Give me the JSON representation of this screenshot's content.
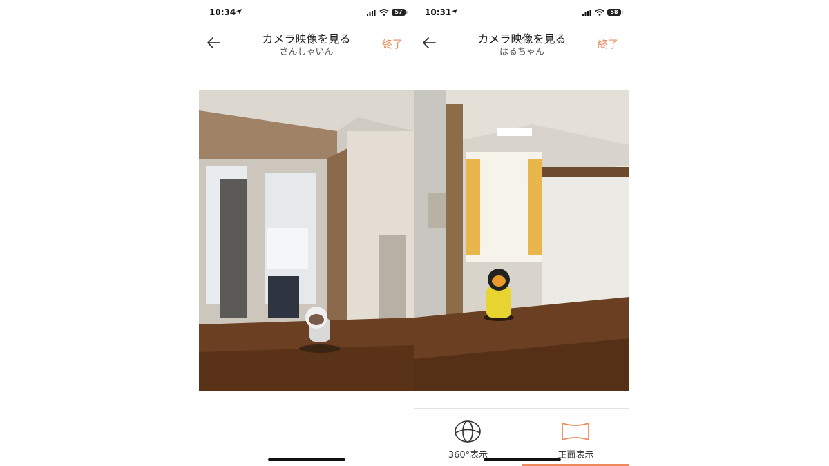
{
  "left_screen": {
    "status": {
      "time": "10:34",
      "battery": "57"
    },
    "nav": {
      "title": "カメラ映像を見る",
      "subtitle": "さんしゃいん",
      "end_label": "終了"
    }
  },
  "right_screen": {
    "status": {
      "time": "10:31",
      "battery": "58"
    },
    "nav": {
      "title": "カメラ映像を見る",
      "subtitle": "はるちゃん",
      "end_label": "終了"
    },
    "view_toggle": {
      "options": [
        {
          "label": "360°表示",
          "icon": "globe-icon",
          "active": false
        },
        {
          "label": "正面表示",
          "icon": "panorama-icon",
          "active": true
        }
      ]
    }
  },
  "colors": {
    "accent": "#ef8a5c",
    "text": "#222222",
    "divider": "#e2e2e2"
  }
}
